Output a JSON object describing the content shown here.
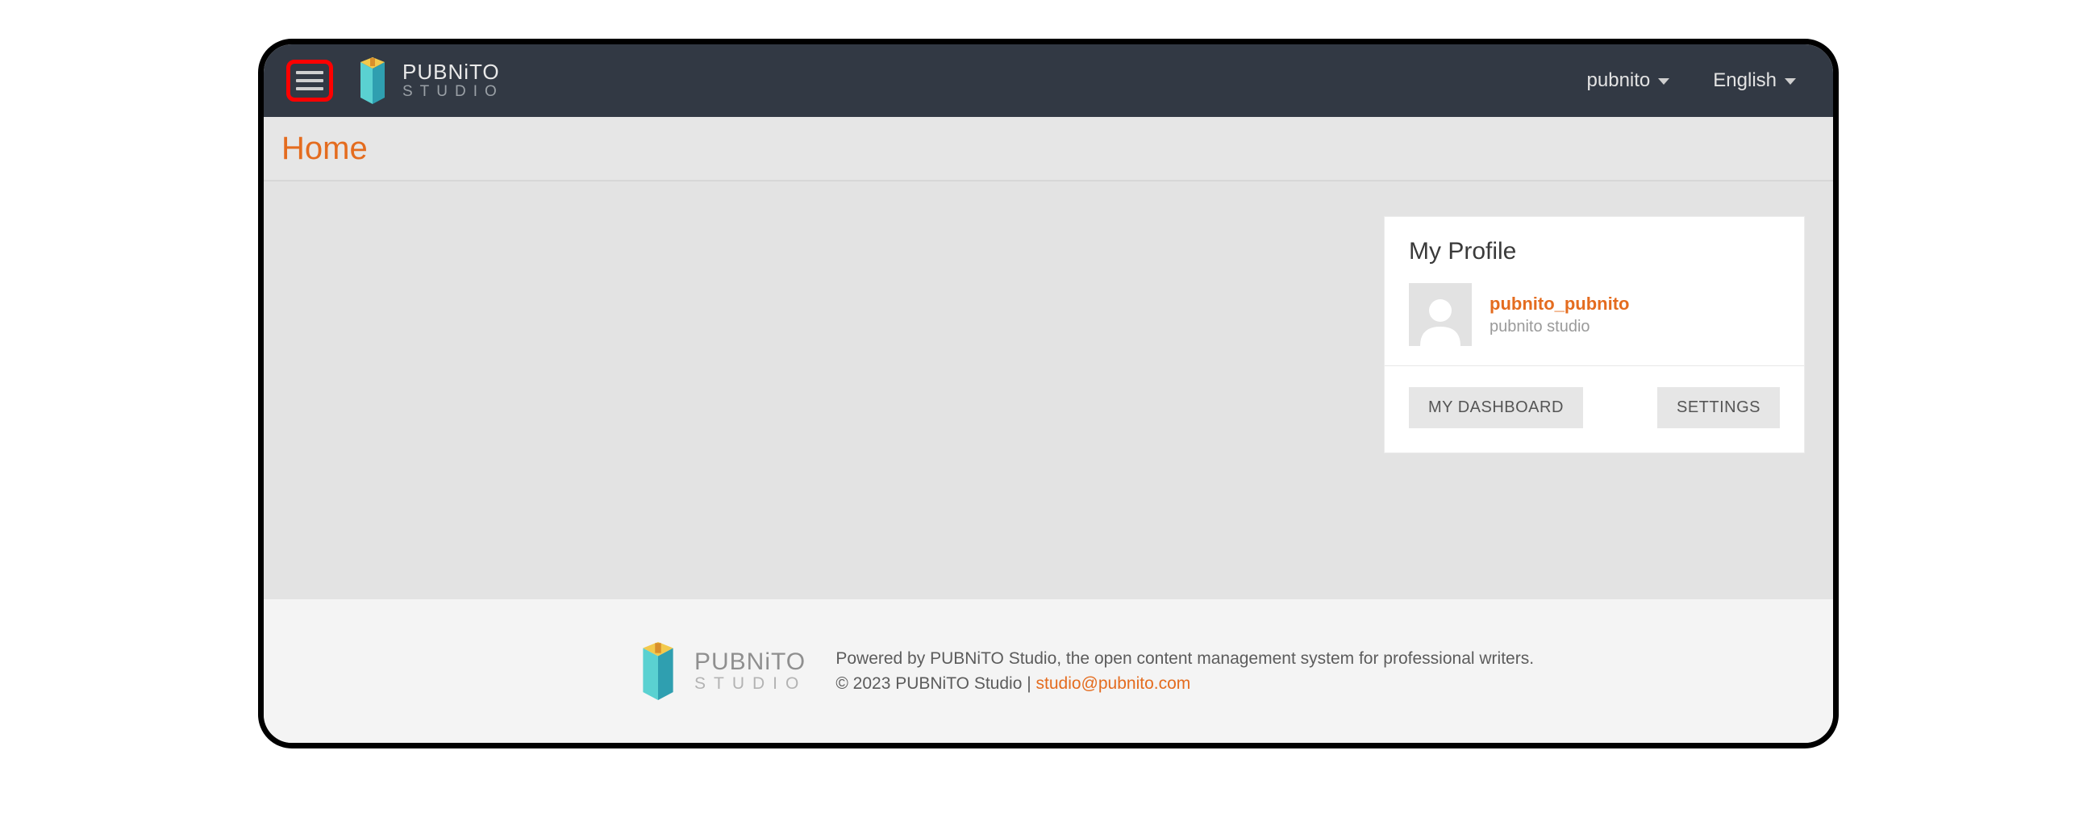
{
  "brand": {
    "title": "PUBNiTO",
    "subtitle": "STUDIO"
  },
  "navbar": {
    "user_menu_label": "pubnito",
    "language_menu_label": "English"
  },
  "page": {
    "title": "Home"
  },
  "profile": {
    "card_title": "My Profile",
    "username": "pubnito_pubnito",
    "org": "pubnito studio",
    "dashboard_button": "MY DASHBOARD",
    "settings_button": "SETTINGS"
  },
  "footer": {
    "brand_title": "PUBNiTO",
    "brand_subtitle": "STUDIO",
    "powered_by": "Powered by PUBNiTO Studio, the open content management system for professional writers.",
    "copyright_prefix": "© 2023 PUBNiTO Studio | ",
    "email": "studio@pubnito.com"
  },
  "colors": {
    "navbar_bg": "#323944",
    "accent": "#e46c1f",
    "highlight_border": "#ff0000"
  }
}
